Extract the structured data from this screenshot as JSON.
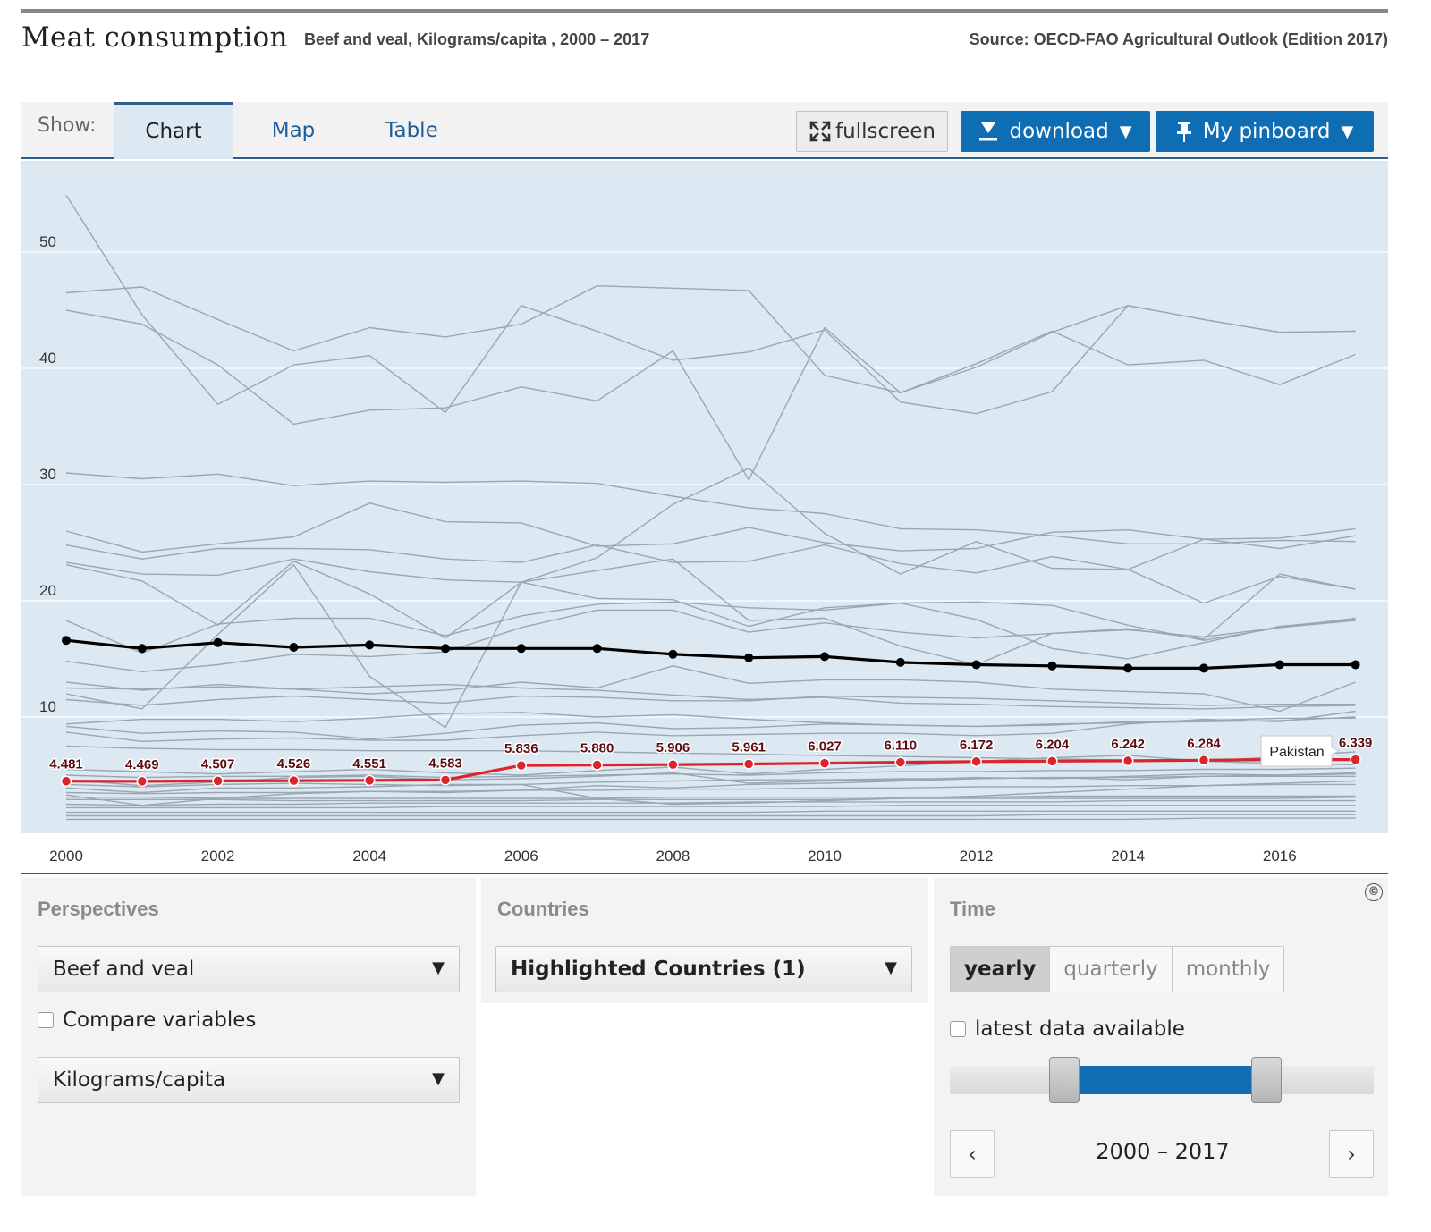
{
  "header": {
    "title": "Meat consumption",
    "subtitle": "Beef and veal, Kilograms/capita , 2000 – 2017",
    "source": "Source: OECD-FAO Agricultural Outlook (Edition 2017)"
  },
  "toolbar": {
    "show_label": "Show:",
    "tabs": [
      {
        "label": "Chart",
        "active": true
      },
      {
        "label": "Map",
        "active": false
      },
      {
        "label": "Table",
        "active": false
      }
    ],
    "fullscreen_label": "fullscreen",
    "download_label": "download",
    "pinboard_label": "My pinboard",
    "caret": "▼"
  },
  "colors": {
    "plot_background": "#dde9f2",
    "grid": "#ffffff",
    "background_series": "#9aa7b2",
    "average_series": "#000000",
    "highlight_series": "#d9252b",
    "button_blue": "#0f6db4"
  },
  "chart_data": {
    "type": "line",
    "ylim": [
      0,
      55
    ],
    "y_ticks": [
      10,
      20,
      30,
      40,
      50
    ],
    "x_ticks": [
      2000,
      2002,
      2004,
      2006,
      2008,
      2010,
      2012,
      2014,
      2016
    ],
    "x": [
      2000,
      2001,
      2002,
      2003,
      2004,
      2005,
      2006,
      2007,
      2008,
      2009,
      2010,
      2011,
      2012,
      2013,
      2014,
      2015,
      2016,
      2017
    ],
    "grid": true,
    "highlighted_series": {
      "name": "Pakistan",
      "values": [
        4.481,
        4.469,
        4.507,
        4.526,
        4.551,
        4.583,
        5.836,
        5.88,
        5.906,
        5.961,
        6.027,
        6.11,
        6.172,
        6.204,
        6.242,
        6.284,
        6.338,
        6.339
      ],
      "labels": [
        "4.481",
        "4.469",
        "4.507",
        "4.526",
        "4.551",
        "4.583",
        "5.836",
        "5.880",
        "5.906",
        "5.961",
        "6.027",
        "6.110",
        "6.172",
        "6.204",
        "6.242",
        "6.284",
        "6.338",
        "6.339"
      ]
    },
    "average_series": {
      "values": [
        16.6,
        15.9,
        16.4,
        16.0,
        16.2,
        15.9,
        15.9,
        15.9,
        15.4,
        15.1,
        15.2,
        14.7,
        14.5,
        14.4,
        14.2,
        14.2,
        14.5,
        14.5
      ]
    },
    "background_series": [
      [
        54.9,
        44.6,
        36.9,
        40.3,
        41.1,
        36.2,
        45.4,
        43.2,
        40.7,
        41.4,
        43.3,
        37.1,
        36.1,
        38.0,
        45.4,
        44.2,
        43.1,
        43.2
      ],
      [
        45.0,
        43.8,
        40.3,
        35.2,
        36.4,
        36.6,
        38.4,
        37.2,
        41.5,
        30.4,
        43.5,
        37.9,
        40.4,
        43.2,
        40.3,
        40.7,
        38.6,
        41.2
      ],
      [
        46.5,
        47.0,
        44.2,
        41.5,
        43.5,
        42.7,
        43.8,
        47.1,
        46.9,
        46.7,
        39.4,
        37.9,
        40.1,
        43.1,
        45.4,
        44.2,
        43.1,
        43.2
      ],
      [
        31.0,
        30.5,
        30.9,
        29.9,
        30.3,
        30.2,
        30.3,
        30.1,
        29.0,
        28.0,
        27.5,
        26.2,
        26.1,
        25.6,
        24.9,
        24.9,
        25.2,
        25.1
      ],
      [
        26.0,
        24.2,
        24.9,
        25.5,
        28.4,
        26.8,
        26.7,
        24.7,
        24.9,
        26.3,
        25.0,
        24.3,
        24.5,
        25.9,
        26.1,
        25.3,
        25.4,
        26.2
      ],
      [
        24.8,
        23.6,
        24.5,
        24.5,
        24.4,
        23.6,
        23.3,
        24.8,
        23.3,
        23.4,
        24.8,
        23.2,
        22.4,
        23.8,
        22.7,
        25.3,
        24.5,
        25.6
      ],
      [
        23.3,
        22.3,
        22.2,
        23.6,
        22.5,
        21.8,
        21.6,
        20.2,
        20.1,
        17.8,
        19.4,
        19.8,
        18.4,
        15.9,
        15.0,
        16.4,
        17.8,
        18.4
      ],
      [
        23.1,
        21.7,
        17.9,
        23.4,
        20.6,
        16.8,
        21.6,
        22.6,
        23.6,
        18.3,
        18.5,
        16.1,
        14.5,
        17.2,
        17.6,
        16.7,
        22.3,
        21.0
      ],
      [
        12.0,
        10.7,
        17.1,
        23.1,
        13.5,
        9.1,
        21.6,
        23.7,
        28.3,
        31.4,
        25.8,
        22.3,
        25.1,
        22.8,
        22.7,
        19.8,
        22.1,
        21.0
      ],
      [
        18.3,
        15.5,
        18.0,
        18.5,
        18.5,
        17.0,
        18.7,
        19.7,
        19.9,
        19.4,
        19.2,
        19.8,
        19.9,
        19.6,
        17.9,
        16.6,
        17.7,
        18.5
      ],
      [
        14.8,
        13.9,
        14.5,
        15.4,
        15.2,
        15.6,
        17.7,
        19.2,
        19.2,
        17.3,
        18.1,
        17.3,
        16.8,
        17.2,
        17.5,
        16.9,
        17.7,
        18.3
      ],
      [
        13.0,
        12.3,
        12.8,
        12.4,
        12.0,
        12.3,
        13.0,
        12.5,
        14.4,
        12.9,
        13.2,
        13.2,
        13.0,
        12.4,
        12.2,
        12.0,
        10.5,
        13.0
      ],
      [
        12.5,
        12.4,
        12.6,
        12.4,
        12.6,
        12.8,
        12.5,
        12.3,
        11.9,
        11.5,
        11.7,
        11.2,
        11.1,
        10.9,
        10.8,
        10.7,
        10.9,
        11.0
      ],
      [
        11.5,
        11.0,
        11.5,
        11.8,
        11.5,
        11.2,
        11.8,
        11.7,
        11.4,
        11.4,
        11.8,
        11.7,
        11.6,
        11.4,
        11.2,
        11.0,
        11.1,
        11.1
      ],
      [
        9.4,
        9.8,
        9.8,
        9.6,
        9.9,
        10.3,
        10.4,
        10.0,
        10.2,
        9.8,
        9.5,
        9.3,
        9.2,
        9.4,
        9.5,
        9.6,
        9.7,
        10.0
      ],
      [
        9.2,
        8.6,
        8.8,
        8.7,
        8.1,
        8.6,
        9.3,
        9.5,
        9.0,
        9.1,
        9.4,
        9.3,
        9.2,
        9.3,
        9.6,
        9.7,
        9.9,
        9.9
      ],
      [
        8.7,
        7.9,
        8.1,
        8.2,
        8.0,
        8.0,
        8.4,
        8.7,
        8.4,
        8.5,
        8.6,
        8.6,
        8.4,
        8.6,
        9.4,
        9.8,
        9.6,
        10.5
      ],
      [
        7.5,
        7.3,
        7.2,
        7.2,
        7.1,
        7.1,
        7.1,
        7.0,
        6.9,
        6.8,
        6.7,
        6.6,
        6.5,
        6.4,
        6.3,
        6.2,
        6.0,
        5.9
      ],
      [
        5.5,
        5.3,
        5.1,
        5.3,
        5.5,
        5.2,
        5.0,
        5.4,
        5.7,
        5.1,
        5.5,
        5.8,
        6.2,
        6.5,
        6.7,
        6.2,
        6.6,
        7.0
      ],
      [
        5.0,
        4.8,
        4.9,
        4.9,
        5.0,
        4.8,
        4.9,
        5.0,
        5.1,
        5.0,
        5.2,
        5.3,
        5.3,
        5.4,
        5.4,
        5.5,
        5.5,
        5.6
      ],
      [
        4.6,
        4.1,
        4.4,
        4.8,
        4.9,
        4.6,
        4.7,
        4.9,
        5.2,
        4.3,
        4.5,
        4.6,
        4.8,
        4.7,
        4.9,
        5.1,
        5.0,
        5.2
      ],
      [
        4.2,
        4.0,
        4.2,
        4.3,
        4.2,
        4.1,
        4.2,
        4.4,
        4.5,
        4.6,
        4.6,
        4.7,
        4.7,
        4.8,
        4.8,
        4.9,
        4.9,
        4.9
      ],
      [
        3.9,
        3.5,
        3.9,
        3.9,
        4.0,
        4.2,
        4.2,
        3.0,
        2.5,
        2.6,
        2.8,
        3.0,
        3.2,
        3.5,
        3.8,
        4.1,
        4.3,
        4.5
      ],
      [
        3.5,
        3.4,
        3.5,
        3.5,
        3.6,
        3.6,
        3.7,
        3.7,
        3.8,
        3.8,
        3.9,
        3.9,
        4.0,
        4.0,
        4.1,
        4.1,
        4.2,
        4.2
      ],
      [
        3.3,
        2.4,
        3.0,
        3.4,
        3.6,
        3.5,
        3.7,
        4.1,
        3.9,
        4.2,
        4.3,
        4.5,
        4.7,
        4.8,
        4.6,
        4.9,
        5.0,
        5.1
      ],
      [
        3.1,
        3.1,
        3.0,
        3.0,
        3.0,
        3.0,
        3.0,
        3.0,
        3.1,
        3.1,
        3.1,
        3.1,
        3.1,
        3.2,
        3.2,
        3.2,
        3.2,
        3.2
      ],
      [
        2.9,
        2.9,
        2.9,
        2.8,
        2.8,
        2.8,
        2.8,
        2.9,
        2.9,
        2.9,
        2.9,
        3.0,
        3.0,
        3.0,
        3.0,
        3.0,
        3.0,
        3.1
      ],
      [
        2.5,
        2.4,
        2.5,
        2.5,
        2.6,
        2.6,
        2.6,
        2.6,
        2.6,
        2.7,
        2.7,
        2.7,
        2.7,
        2.7,
        2.8,
        2.8,
        2.8,
        2.8
      ],
      [
        2.2,
        2.2,
        2.2,
        2.2,
        2.2,
        2.3,
        2.3,
        2.3,
        2.3,
        2.3,
        2.3,
        2.4,
        2.4,
        2.4,
        2.4,
        2.4,
        2.4,
        2.4
      ],
      [
        1.8,
        1.8,
        1.8,
        1.8,
        1.8,
        1.8,
        1.8,
        1.8,
        1.8,
        1.8,
        1.9,
        1.9,
        1.9,
        1.9,
        1.9,
        1.9,
        1.9,
        1.9
      ],
      [
        1.5,
        1.5,
        1.5,
        1.5,
        1.5,
        1.5,
        1.5,
        1.5,
        1.5,
        1.5,
        1.5,
        1.5,
        1.5,
        1.6,
        1.6,
        1.6,
        1.6,
        1.6
      ],
      [
        1.2,
        1.2,
        1.2,
        1.2,
        1.2,
        1.2,
        1.2,
        1.2,
        1.2,
        1.2,
        1.2,
        1.2,
        1.2,
        1.2,
        1.2,
        1.3,
        1.3,
        1.3
      ]
    ],
    "tooltip_label": "Pakistan"
  },
  "controls": {
    "perspectives": {
      "title": "Perspectives",
      "variable": "Beef and veal",
      "compare_label": "Compare variables",
      "compare_checked": false,
      "unit": "Kilograms/capita"
    },
    "countries": {
      "title": "Countries",
      "selection": "Highlighted Countries (1)"
    },
    "time": {
      "title": "Time",
      "frequencies": [
        {
          "label": "yearly",
          "active": true
        },
        {
          "label": "quarterly",
          "active": false
        },
        {
          "label": "monthly",
          "active": false
        }
      ],
      "latest_label": "latest data available",
      "latest_checked": false,
      "range_text": "2000 – 2017",
      "prev_symbol": "‹",
      "next_symbol": "›",
      "copyright_symbol": "©"
    }
  }
}
